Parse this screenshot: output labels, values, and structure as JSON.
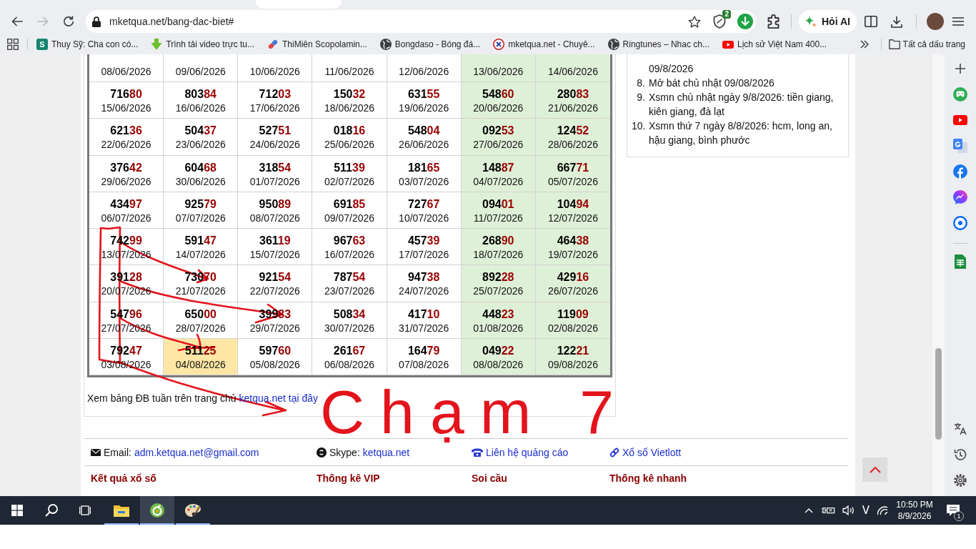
{
  "browser": {
    "navigation": [
      {
        "kind": "back",
        "disabled": false
      },
      {
        "kind": "forward",
        "disabled": true
      },
      {
        "kind": "reload",
        "disabled": false
      }
    ],
    "address_bar": {
      "url": "mketqua.net/bang-dac-biet#"
    },
    "extension_badge": "2",
    "ask_ai_button": "Hỏi AI",
    "bookmarks": [
      {
        "label": "Thuy Sỹ: Cha con có...",
        "kind": "tile",
        "letter": "S"
      },
      {
        "label": "Trình tải video trực tu...",
        "kind": "download"
      },
      {
        "label": "ThiMiên Scopolamin...",
        "kind": "pill"
      },
      {
        "label": "Bongdaso - Bóng đá...",
        "kind": "globe"
      },
      {
        "label": "mketqua.net - Chuyê...",
        "kind": "logo"
      },
      {
        "label": "Ringtunes – Nhac ch...",
        "kind": "globe"
      },
      {
        "label": "Lịch sử Việt Nam 400...",
        "kind": "video"
      }
    ],
    "all_bookmarks": "Tất cả dấu trang"
  },
  "results_table": {
    "rows": [
      [
        {
          "date": "08/06/2026",
          "weekend": false,
          "highlighted": false
        },
        {
          "date": "09/06/2026",
          "weekend": false,
          "highlighted": false
        },
        {
          "date": "10/06/2026",
          "weekend": false,
          "highlighted": false
        },
        {
          "date": "11/06/2026",
          "weekend": false,
          "highlighted": false
        },
        {
          "date": "12/06/2026",
          "weekend": false,
          "highlighted": false
        },
        {
          "date": "13/06/2026",
          "weekend": true,
          "highlighted": false
        },
        {
          "date": "14/06/2026",
          "weekend": true,
          "highlighted": false
        }
      ],
      [
        {
          "number": "71680",
          "date": "15/06/2026",
          "weekend": false,
          "highlighted": false
        },
        {
          "number": "80384",
          "date": "16/06/2026",
          "weekend": false,
          "highlighted": false
        },
        {
          "number": "71203",
          "date": "17/06/2026",
          "weekend": false,
          "highlighted": false
        },
        {
          "number": "15032",
          "date": "18/06/2026",
          "weekend": false,
          "highlighted": false
        },
        {
          "number": "63155",
          "date": "19/06/2026",
          "weekend": false,
          "highlighted": false
        },
        {
          "number": "54860",
          "date": "20/06/2026",
          "weekend": true,
          "highlighted": false
        },
        {
          "number": "28083",
          "date": "21/06/2026",
          "weekend": true,
          "highlighted": false
        }
      ],
      [
        {
          "number": "62136",
          "date": "22/06/2026",
          "weekend": false,
          "highlighted": false
        },
        {
          "number": "50437",
          "date": "23/06/2026",
          "weekend": false,
          "highlighted": false
        },
        {
          "number": "52751",
          "date": "24/06/2026",
          "weekend": false,
          "highlighted": false
        },
        {
          "number": "01816",
          "date": "25/06/2026",
          "weekend": false,
          "highlighted": false
        },
        {
          "number": "54804",
          "date": "26/06/2026",
          "weekend": false,
          "highlighted": false
        },
        {
          "number": "09253",
          "date": "27/06/2026",
          "weekend": true,
          "highlighted": false
        },
        {
          "number": "12452",
          "date": "28/06/2026",
          "weekend": true,
          "highlighted": false
        }
      ],
      [
        {
          "number": "37642",
          "date": "29/06/2026",
          "weekend": false,
          "highlighted": false
        },
        {
          "number": "60468",
          "date": "30/06/2026",
          "weekend": false,
          "highlighted": false
        },
        {
          "number": "31854",
          "date": "01/07/2026",
          "weekend": false,
          "highlighted": false
        },
        {
          "number": "51139",
          "date": "02/07/2026",
          "weekend": false,
          "highlighted": false
        },
        {
          "number": "18165",
          "date": "03/07/2026",
          "weekend": false,
          "highlighted": false
        },
        {
          "number": "14887",
          "date": "04/07/2026",
          "weekend": true,
          "highlighted": false
        },
        {
          "number": "66771",
          "date": "05/07/2026",
          "weekend": true,
          "highlighted": false
        }
      ],
      [
        {
          "number": "43497",
          "date": "06/07/2026",
          "weekend": false,
          "highlighted": false
        },
        {
          "number": "92579",
          "date": "07/07/2026",
          "weekend": false,
          "highlighted": false
        },
        {
          "number": "95089",
          "date": "08/07/2026",
          "weekend": false,
          "highlighted": false
        },
        {
          "number": "69185",
          "date": "09/07/2026",
          "weekend": false,
          "highlighted": false
        },
        {
          "number": "72767",
          "date": "10/07/2026",
          "weekend": false,
          "highlighted": false
        },
        {
          "number": "09401",
          "date": "11/07/2026",
          "weekend": true,
          "highlighted": false
        },
        {
          "number": "10494",
          "date": "12/07/2026",
          "weekend": true,
          "highlighted": false
        }
      ],
      [
        {
          "number": "74299",
          "date": "13/07/2026",
          "weekend": false,
          "highlighted": false
        },
        {
          "number": "59147",
          "date": "14/07/2026",
          "weekend": false,
          "highlighted": false
        },
        {
          "number": "36119",
          "date": "15/07/2026",
          "weekend": false,
          "highlighted": false
        },
        {
          "number": "96763",
          "date": "16/07/2026",
          "weekend": false,
          "highlighted": false
        },
        {
          "number": "45739",
          "date": "17/07/2026",
          "weekend": false,
          "highlighted": false
        },
        {
          "number": "26890",
          "date": "18/07/2026",
          "weekend": true,
          "highlighted": false
        },
        {
          "number": "46438",
          "date": "19/07/2026",
          "weekend": true,
          "highlighted": false
        }
      ],
      [
        {
          "number": "39128",
          "date": "20/07/2026",
          "weekend": false,
          "highlighted": false
        },
        {
          "number": "73070",
          "date": "21/07/2026",
          "weekend": false,
          "highlighted": false
        },
        {
          "number": "92154",
          "date": "22/07/2026",
          "weekend": false,
          "highlighted": false
        },
        {
          "number": "78754",
          "date": "23/07/2026",
          "weekend": false,
          "highlighted": false
        },
        {
          "number": "94738",
          "date": "24/07/2026",
          "weekend": false,
          "highlighted": false
        },
        {
          "number": "89228",
          "date": "25/07/2026",
          "weekend": true,
          "highlighted": false
        },
        {
          "number": "42916",
          "date": "26/07/2026",
          "weekend": true,
          "highlighted": false
        }
      ],
      [
        {
          "number": "54796",
          "date": "27/07/2026",
          "weekend": false,
          "highlighted": false
        },
        {
          "number": "65000",
          "date": "28/07/2026",
          "weekend": false,
          "highlighted": false
        },
        {
          "number": "39983",
          "date": "29/07/2026",
          "weekend": false,
          "highlighted": false
        },
        {
          "number": "50834",
          "date": "30/07/2026",
          "weekend": false,
          "highlighted": false
        },
        {
          "number": "41710",
          "date": "31/07/2026",
          "weekend": false,
          "highlighted": false
        },
        {
          "number": "44823",
          "date": "01/08/2026",
          "weekend": true,
          "highlighted": false
        },
        {
          "number": "11909",
          "date": "02/08/2026",
          "weekend": true,
          "highlighted": false
        }
      ],
      [
        {
          "number": "79247",
          "date": "03/08/2026",
          "weekend": false,
          "highlighted": false
        },
        {
          "number": "51125",
          "date": "04/08/2026",
          "weekend": false,
          "highlighted": true
        },
        {
          "number": "59760",
          "date": "05/08/2026",
          "weekend": false,
          "highlighted": false
        },
        {
          "number": "26167",
          "date": "06/08/2026",
          "weekend": false,
          "highlighted": false
        },
        {
          "number": "16479",
          "date": "07/08/2026",
          "weekend": false,
          "highlighted": false
        },
        {
          "number": "04922",
          "date": "08/08/2026",
          "weekend": true,
          "highlighted": false
        },
        {
          "number": "12221",
          "date": "09/08/2026",
          "weekend": true,
          "highlighted": false
        }
      ]
    ]
  },
  "table_note": {
    "text": "Xem bảng ĐB tuần trên trang chủ",
    "link": "ketqua.net tại đây"
  },
  "news_list": [
    {
      "text": "09/8/2026"
    },
    {
      "number": "8.",
      "text": "Mở bát chủ nhật 09/08/2026"
    },
    {
      "number": "9.",
      "text": "Xsmn chủ nhật ngày 9/8/2026: tiền giang, kiên giang, đà lạt"
    },
    {
      "number": "10.",
      "text": "Xsmn thứ 7 ngày 8/8/2026: hcm, long an, hậu giang, bình phước"
    }
  ],
  "footer": {
    "contacts": [
      {
        "kind": "email",
        "label": "Email:",
        "link": "adm.ketqua.net@gmail.com"
      },
      {
        "kind": "skype",
        "label": "Skype:",
        "link": "ketqua.net"
      },
      {
        "kind": "phone",
        "link": "Liên hệ quảng cáo"
      },
      {
        "kind": "web",
        "link": "Xổ số Vietlott"
      }
    ],
    "headings": [
      "Kết quả xổ số",
      "Thống kê VIP",
      "Soi cầu",
      "Thống kê nhanh"
    ]
  },
  "annotation": {
    "text": "Chạm 7"
  },
  "taskbar": {
    "apps": [
      {
        "kind": "explorer",
        "running": true,
        "selected": false
      },
      {
        "kind": "browser",
        "running": true,
        "selected": true
      },
      {
        "kind": "paint",
        "running": true,
        "selected": false
      }
    ],
    "input_method": "V",
    "time": "10:50 PM",
    "date": "8/9/2026",
    "notification_count": "1"
  }
}
